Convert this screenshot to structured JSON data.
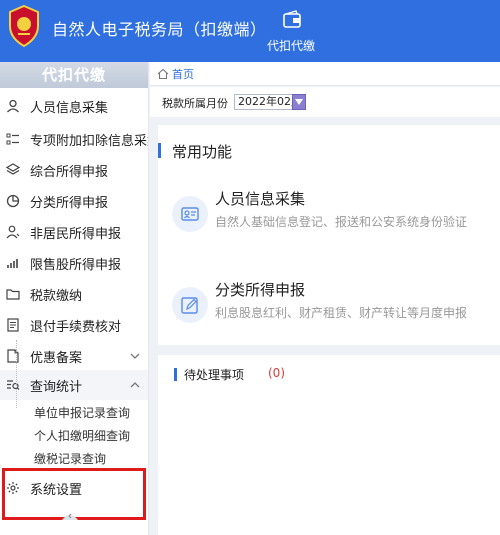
{
  "header": {
    "title": "自然人电子税务局（扣缴端）",
    "nav_label": "代扣代缴",
    "nav_icon": "wallet-icon"
  },
  "sidebar": {
    "heading": "代扣代缴",
    "items": [
      {
        "label": "人员信息采集",
        "icon": "person-icon"
      },
      {
        "label": "专项附加扣除信息采集",
        "icon": "list-icon"
      },
      {
        "label": "综合所得申报",
        "icon": "layers-icon"
      },
      {
        "label": "分类所得申报",
        "icon": "pie-icon"
      },
      {
        "label": "非居民所得申报",
        "icon": "user-outline-icon"
      },
      {
        "label": "限售股所得申报",
        "icon": "bar-chart-icon"
      },
      {
        "label": "税款缴纳",
        "icon": "folder-icon"
      },
      {
        "label": "退付手续费核对",
        "icon": "document-icon"
      },
      {
        "label": "优惠备案",
        "icon": "file-icon"
      },
      {
        "label": "查询统计",
        "icon": "search-list-icon"
      }
    ],
    "submenu": [
      "单位申报记录查询",
      "个人扣缴明细查询",
      "缴税记录查询"
    ],
    "settings_label": "系统设置"
  },
  "breadcrumb": {
    "home": "首页"
  },
  "period": {
    "label": "税款所属月份",
    "value": "2022年02月"
  },
  "common": {
    "title": "常用功能",
    "cards": [
      {
        "title": "人员信息采集",
        "desc": "自然人基础信息登记、报送和公安系统身份验证"
      },
      {
        "title": "分类所得申报",
        "desc": "利息股息红利、财产租赁、财产转让等月度申报"
      }
    ]
  },
  "pending": {
    "title": "待处理事项",
    "count": "(0)"
  },
  "colors": {
    "primary": "#2f6fe0",
    "highlight": "#e01a1a",
    "count": "#e03a3a"
  }
}
